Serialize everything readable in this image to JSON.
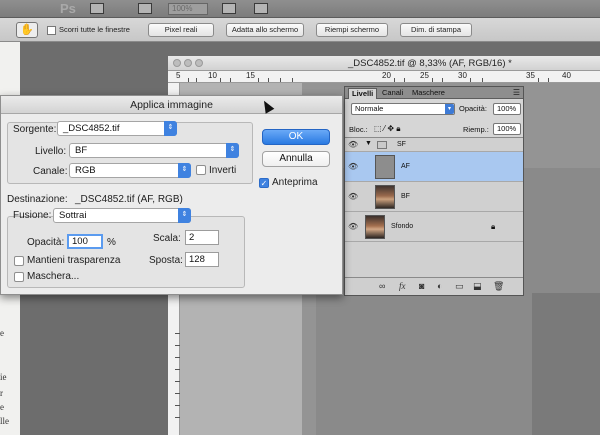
{
  "app": {
    "logo": "Ps",
    "zoom_value": "100%"
  },
  "options_bar": {
    "scroll_all_label": "Scorri tutte le finestre",
    "buttons": [
      "Pixel reali",
      "Adatta allo schermo",
      "Riempi schermo",
      "Dim. di stampa"
    ]
  },
  "document": {
    "title": "_DSC4852.tif @ 8,33% (AF, RGB/16) *",
    "ruler_labels": [
      "5",
      "10",
      "15",
      "20",
      "25",
      "30",
      "35",
      "40"
    ]
  },
  "layers_panel": {
    "tabs": [
      "Livelli",
      "Canali",
      "Maschere"
    ],
    "blend_mode": "Normale",
    "opacity_label": "Opacità:",
    "opacity_value": "100%",
    "lock_label": "Bloc.:",
    "fill_label": "Riemp.:",
    "fill_value": "100%",
    "layers": [
      {
        "name": "SF",
        "kind": "group"
      },
      {
        "name": "AF",
        "kind": "layer",
        "selected": true
      },
      {
        "name": "BF",
        "kind": "layer"
      },
      {
        "name": "Sfondo",
        "kind": "background",
        "locked": true
      }
    ],
    "footer_icons": [
      "link-icon",
      "fx-icon",
      "mask-icon",
      "adjustment-icon",
      "folder-icon",
      "new-layer-icon",
      "trash-icon"
    ]
  },
  "dialog": {
    "title": "Applica immagine",
    "source_label": "Sorgente:",
    "source_value": "_DSC4852.tif",
    "layer_label": "Livello:",
    "layer_value": "BF",
    "channel_label": "Canale:",
    "channel_value": "RGB",
    "invert_label": "Inverti",
    "destination_label": "Destinazione:",
    "destination_value": "_DSC4852.tif (AF, RGB)",
    "blending_label": "Fusione:",
    "blending_value": "Sottrai",
    "opacity_label": "Opacità:",
    "opacity_value": "100",
    "opacity_unit": "%",
    "scale_label": "Scala:",
    "scale_value": "2",
    "offset_label": "Sposta:",
    "offset_value": "128",
    "preserve_transparency_label": "Mantieni trasparenza",
    "mask_label": "Maschera...",
    "ok_label": "OK",
    "cancel_label": "Annulla",
    "preview_label": "Anteprima",
    "preview_checked": true
  },
  "left_text": [
    "e",
    "ie",
    "r",
    "e",
    "lle"
  ],
  "colors": {
    "accent_blue": "#3f82e0",
    "selected_layer": "#a9c8f0"
  }
}
